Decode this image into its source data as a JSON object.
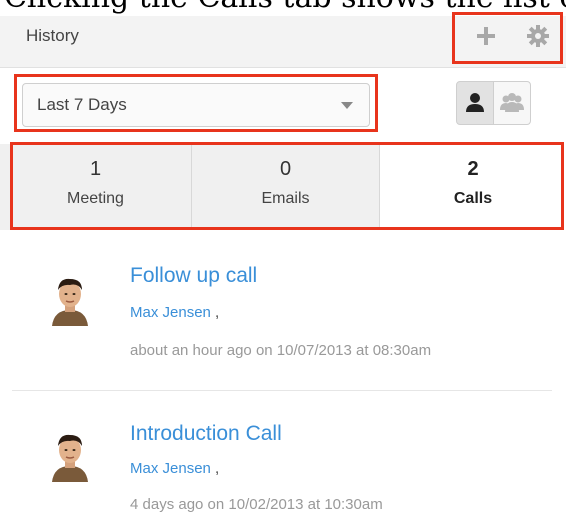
{
  "caption": "Clicking the Calls tab shows the list of calls related to the record",
  "header": {
    "title": "History",
    "add_icon": "plus-icon",
    "settings_icon": "gear-icon"
  },
  "filter": {
    "selected": "Last 7 Days",
    "view_icons": [
      "single-user-icon",
      "group-users-icon"
    ]
  },
  "stats": [
    {
      "count": "1",
      "label": "Meeting"
    },
    {
      "count": "0",
      "label": "Emails"
    },
    {
      "count": "2",
      "label": "Calls"
    }
  ],
  "items": [
    {
      "title": "Follow up call",
      "person": "Max Jensen",
      "separator": ",",
      "time": "about an hour ago on 10/07/2013 at 08:30am"
    },
    {
      "title": "Introduction Call",
      "person": "Max Jensen",
      "separator": ",",
      "time": "4 days ago on 10/02/2013 at 10:30am"
    }
  ],
  "colors": {
    "accent": "#3a8fd8",
    "highlight": "#e8341c"
  }
}
